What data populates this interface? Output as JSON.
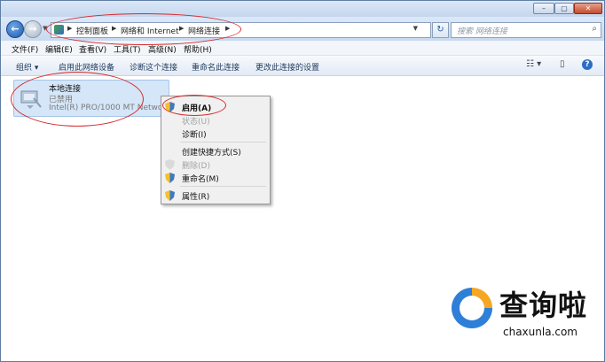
{
  "address": {
    "breadcrumbs": [
      "控制面板",
      "网络和 Internet",
      "网络连接"
    ],
    "search_placeholder": "搜索 网络连接"
  },
  "menu": [
    "文件(F)",
    "编辑(E)",
    "查看(V)",
    "工具(T)",
    "高级(N)",
    "帮助(H)"
  ],
  "commands": [
    "组织",
    "启用此网络设备",
    "诊断这个连接",
    "重命名此连接",
    "更改此连接的设置"
  ],
  "connection": {
    "name": "本地连接",
    "status": "已禁用",
    "device": "Intel(R) PRO/1000 MT Networ..."
  },
  "context_menu": [
    {
      "label": "启用(A)",
      "disabled": false,
      "bold": true,
      "shield": true
    },
    {
      "label": "状态(U)",
      "disabled": true,
      "bold": false,
      "shield": false
    },
    {
      "label": "诊断(I)",
      "disabled": false,
      "bold": false,
      "shield": false
    },
    {
      "label": "创建快捷方式(S)",
      "disabled": false,
      "bold": false,
      "shield": false
    },
    {
      "label": "删除(D)",
      "disabled": true,
      "bold": false,
      "shield": true
    },
    {
      "label": "重命名(M)",
      "disabled": false,
      "bold": false,
      "shield": true
    },
    {
      "label": "属性(R)",
      "disabled": false,
      "bold": false,
      "shield": true
    }
  ],
  "watermark": {
    "name": "查询啦",
    "url": "chaxunla.com"
  },
  "colors": {
    "annotation": "#d62a2a",
    "selection": "#d5e6f8",
    "accent": "#2e7fd8"
  }
}
